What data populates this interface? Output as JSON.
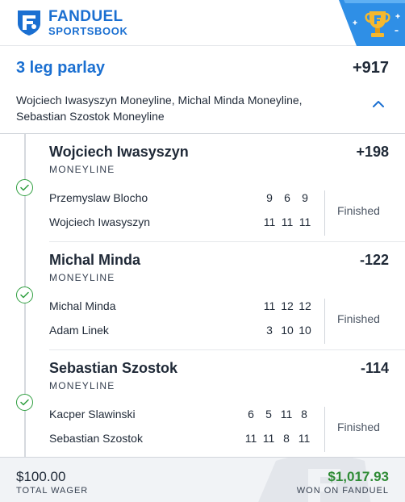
{
  "header": {
    "brand_line1": "FANDUEL",
    "brand_line2": "SPORTSBOOK",
    "brand_color": "#1a6fd1",
    "logo_icon": "fanduel-shield-icon",
    "badge_icon": "trophy-icon"
  },
  "parlay": {
    "title": "3 leg parlay",
    "odds": "+917",
    "description": "Wojciech Iwasyszyn Moneyline, Michal Minda Moneyline, Sebastian Szostok Moneyline",
    "toggle_icon": "chevron-up-icon"
  },
  "legs": [
    {
      "name": "Wojciech Iwasyszyn",
      "odds": "+198",
      "market": "MONEYLINE",
      "status": "Finished",
      "players": [
        {
          "name": "Przemyslaw Blocho",
          "scores": [
            "9",
            "6",
            "9"
          ]
        },
        {
          "name": "Wojciech Iwasyszyn",
          "scores": [
            "11",
            "11",
            "11"
          ]
        }
      ]
    },
    {
      "name": "Michal Minda",
      "odds": "-122",
      "market": "MONEYLINE",
      "status": "Finished",
      "players": [
        {
          "name": "Michal Minda",
          "scores": [
            "11",
            "12",
            "12"
          ]
        },
        {
          "name": "Adam Linek",
          "scores": [
            "3",
            "10",
            "10"
          ]
        }
      ]
    },
    {
      "name": "Sebastian Szostok",
      "odds": "-114",
      "market": "MONEYLINE",
      "status": "Finished",
      "players": [
        {
          "name": "Kacper Slawinski",
          "scores": [
            "6",
            "5",
            "11",
            "8"
          ]
        },
        {
          "name": "Sebastian Szostok",
          "scores": [
            "11",
            "11",
            "8",
            "11"
          ]
        }
      ]
    }
  ],
  "footer": {
    "wager": "$100.00",
    "wager_label": "TOTAL WAGER",
    "won": "$1,017.93",
    "won_label": "WON ON FANDUEL",
    "won_color": "#2e8b35"
  },
  "colors": {
    "win_check": "#2e9e3e"
  }
}
